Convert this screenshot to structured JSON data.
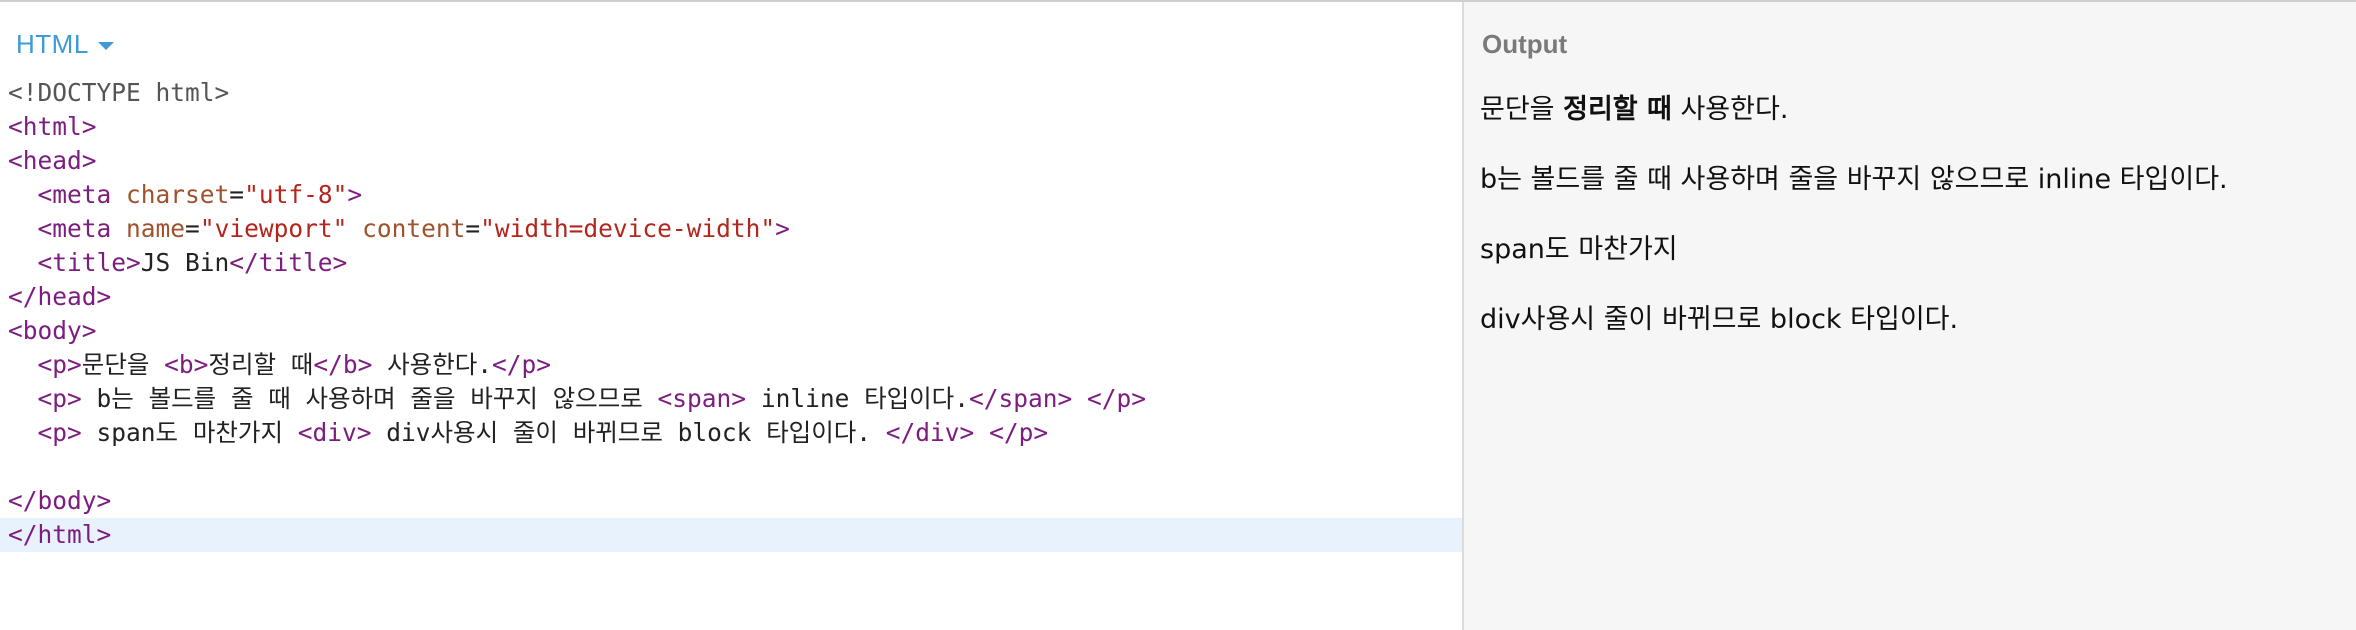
{
  "editor": {
    "tab_label": "HTML",
    "lines": [
      {
        "tokens": [
          {
            "t": "meta",
            "v": "<!DOCTYPE html>"
          }
        ]
      },
      {
        "tokens": [
          {
            "t": "tag",
            "v": "<html>"
          }
        ]
      },
      {
        "tokens": [
          {
            "t": "tag",
            "v": "<head>"
          }
        ]
      },
      {
        "tokens": [
          {
            "t": "text",
            "v": "  "
          },
          {
            "t": "tag",
            "v": "<meta "
          },
          {
            "t": "attr",
            "v": "charset"
          },
          {
            "t": "text",
            "v": "="
          },
          {
            "t": "str",
            "v": "\"utf-8\""
          },
          {
            "t": "tag",
            "v": ">"
          }
        ]
      },
      {
        "tokens": [
          {
            "t": "text",
            "v": "  "
          },
          {
            "t": "tag",
            "v": "<meta "
          },
          {
            "t": "attr",
            "v": "name"
          },
          {
            "t": "text",
            "v": "="
          },
          {
            "t": "str",
            "v": "\"viewport\""
          },
          {
            "t": "text",
            "v": " "
          },
          {
            "t": "attr",
            "v": "content"
          },
          {
            "t": "text",
            "v": "="
          },
          {
            "t": "str",
            "v": "\"width=device-width\""
          },
          {
            "t": "tag",
            "v": ">"
          }
        ]
      },
      {
        "tokens": [
          {
            "t": "text",
            "v": "  "
          },
          {
            "t": "tag",
            "v": "<title>"
          },
          {
            "t": "text",
            "v": "JS Bin"
          },
          {
            "t": "tag",
            "v": "</title>"
          }
        ]
      },
      {
        "tokens": [
          {
            "t": "tag",
            "v": "</head>"
          }
        ]
      },
      {
        "tokens": [
          {
            "t": "tag",
            "v": "<body>"
          }
        ]
      },
      {
        "tokens": [
          {
            "t": "text",
            "v": "  "
          },
          {
            "t": "tag",
            "v": "<p>"
          },
          {
            "t": "text",
            "v": "문단을 "
          },
          {
            "t": "tag",
            "v": "<b>"
          },
          {
            "t": "text",
            "v": "정리할 때"
          },
          {
            "t": "tag",
            "v": "</b>"
          },
          {
            "t": "text",
            "v": " 사용한다."
          },
          {
            "t": "tag",
            "v": "</p>"
          }
        ]
      },
      {
        "tokens": [
          {
            "t": "text",
            "v": "  "
          },
          {
            "t": "tag",
            "v": "<p>"
          },
          {
            "t": "text",
            "v": " b는 볼드를 줄 때 사용하며 줄을 바꾸지 않으므로 "
          },
          {
            "t": "tag",
            "v": "<span>"
          },
          {
            "t": "text",
            "v": " inline 타입이다."
          },
          {
            "t": "tag",
            "v": "</span>"
          },
          {
            "t": "text",
            "v": " "
          },
          {
            "t": "tag",
            "v": "</p>"
          }
        ]
      },
      {
        "tokens": [
          {
            "t": "text",
            "v": "  "
          },
          {
            "t": "tag",
            "v": "<p>"
          },
          {
            "t": "text",
            "v": " span도 마찬가지 "
          },
          {
            "t": "tag",
            "v": "<div>"
          },
          {
            "t": "text",
            "v": " div사용시 줄이 바뀌므로 block 타입이다. "
          },
          {
            "t": "tag",
            "v": "</div>"
          },
          {
            "t": "text",
            "v": " "
          },
          {
            "t": "tag",
            "v": "</p>"
          }
        ]
      },
      {
        "tokens": []
      },
      {
        "tokens": [
          {
            "t": "tag",
            "v": "</body>"
          }
        ]
      },
      {
        "tokens": [
          {
            "t": "tag",
            "v": "</html>"
          }
        ],
        "active": true
      }
    ]
  },
  "output": {
    "title": "Output",
    "p1": {
      "before": "문단을 ",
      "bold": "정리할 때",
      "after": " 사용한다."
    },
    "p2": "b는 볼드를 줄 때 사용하며 줄을 바꾸지 않으므로 inline 타입이다.",
    "p3": "span도 마찬가지",
    "p4": "div사용시 줄이 바뀌므로 block 타입이다."
  },
  "colors": {
    "tab_accent": "#3e9ad8",
    "tag": "#7d1d80",
    "attribute": "#a0522d",
    "string": "#b3261e",
    "doctype": "#555555",
    "active_line": "#e8f2fc",
    "output_background": "#f6f6f6"
  }
}
